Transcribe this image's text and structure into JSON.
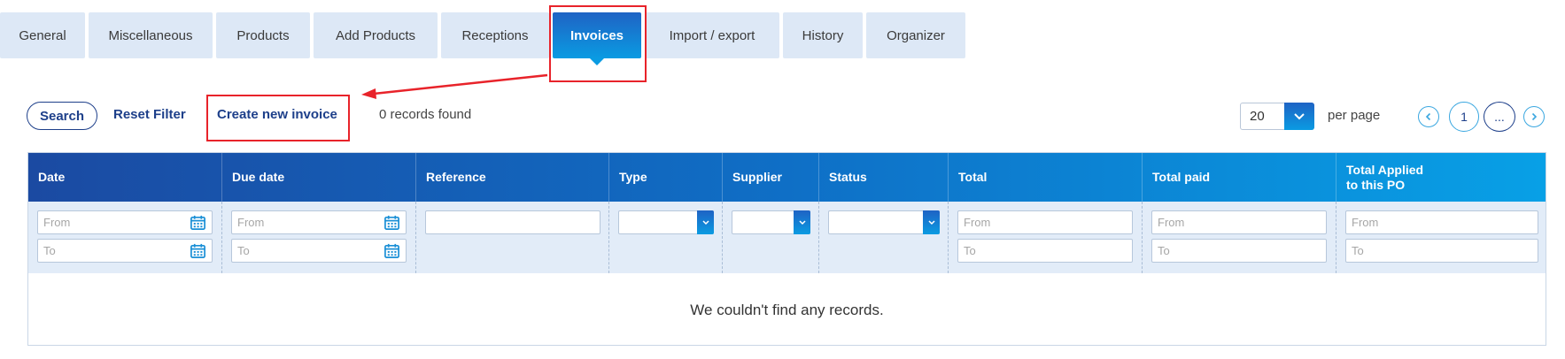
{
  "tabs": [
    {
      "label": "General"
    },
    {
      "label": "Miscellaneous"
    },
    {
      "label": "Products"
    },
    {
      "label": "Add Products"
    },
    {
      "label": "Receptions"
    },
    {
      "label": "Invoices",
      "active": true
    },
    {
      "label": "Import / export"
    },
    {
      "label": "History"
    },
    {
      "label": "Organizer"
    }
  ],
  "toolbar": {
    "search_label": "Search",
    "reset_label": "Reset Filter",
    "create_label": "Create new invoice",
    "records_text": "0 records found"
  },
  "pagination": {
    "per_page_value": "20",
    "per_page_label": "per page",
    "current_page": "1",
    "more_label": "...",
    "prev_icon": "chevron-left-icon",
    "next_icon": "chevron-right-icon"
  },
  "table": {
    "columns": [
      "Date",
      "Due date",
      "Reference",
      "Type",
      "Supplier",
      "Status",
      "Total",
      "Total paid",
      "Total Applied\nto this PO"
    ],
    "filters": {
      "from_placeholder": "From",
      "to_placeholder": "To"
    },
    "empty_message": "We couldn't find any records."
  },
  "colors": {
    "accent_dark": "#1b4aa2",
    "accent_light": "#08a0e6",
    "highlight": "#e8232a",
    "link": "#1d3f8a"
  }
}
